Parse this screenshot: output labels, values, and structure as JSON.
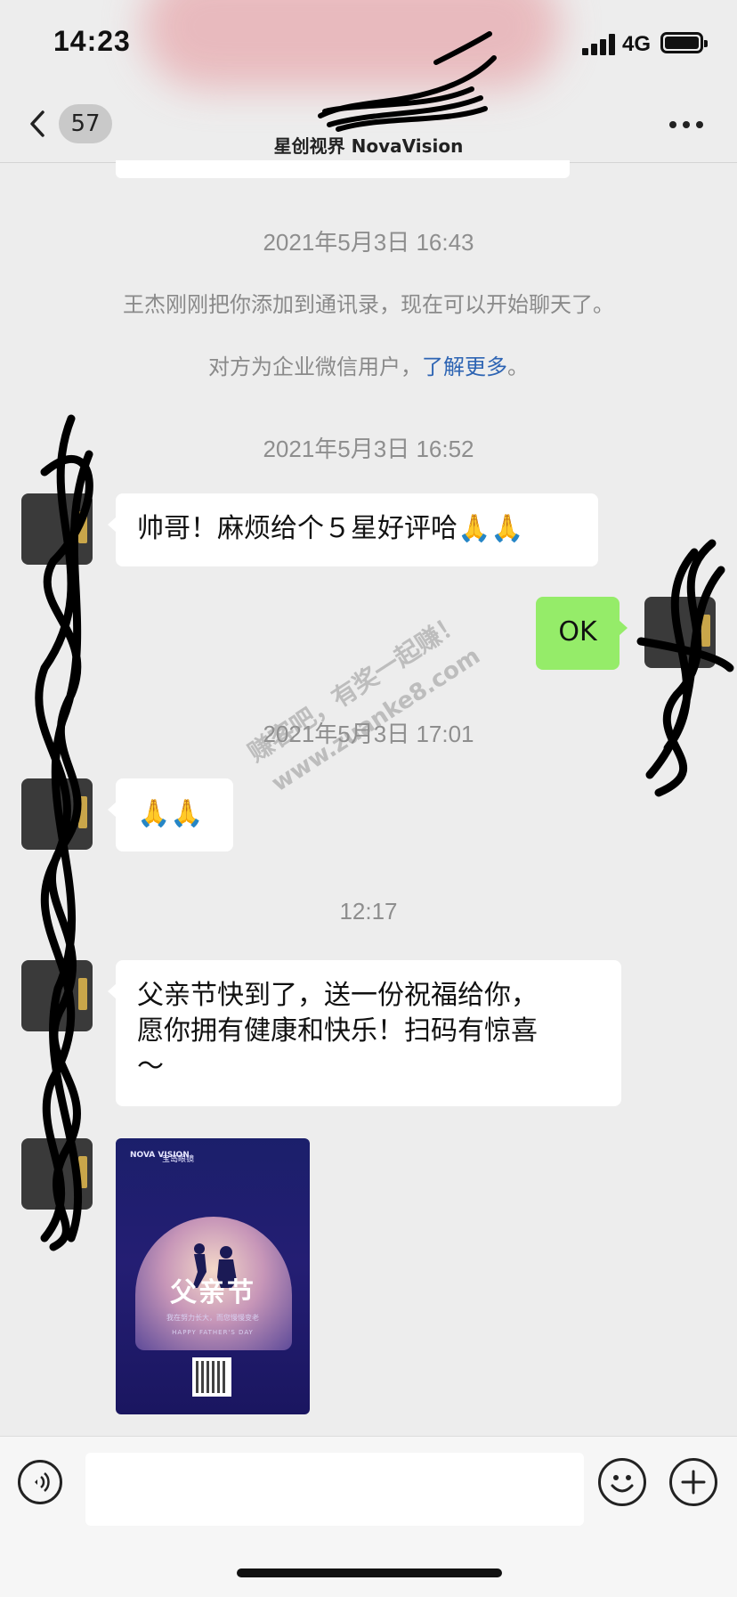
{
  "status": {
    "time": "14:23",
    "network": "4G"
  },
  "nav": {
    "back_count": "57",
    "title": "星创视界 NovaVision"
  },
  "messages": {
    "ts1": "2021年5月3日 16:43",
    "sys1": "王杰刚刚把你添加到通讯录，现在可以开始聊天了。",
    "sys2_prefix": "对方为企业微信用户，",
    "sys2_link": "了解更多",
    "sys2_suffix": "。",
    "ts2": "2021年5月3日 16:52",
    "msg1": "帅哥！麻烦给个５星好评哈",
    "msg1_emoji": "🙏🙏",
    "msg2_out": "OK",
    "ts3": "2021年5月3日 17:01",
    "msg3_emoji": "🙏🙏",
    "ts4": "12:17",
    "msg4_line1": "父亲节快到了，送一份祝福给你，",
    "msg4_line2": "愿你拥有健康和快乐！扫码有惊喜",
    "msg4_line3": "～"
  },
  "poster": {
    "brand": "NOVA VISION",
    "brand_cn": "星创视界",
    "partner": "宝岛眼镜",
    "headline": "父亲节",
    "subline": "我在努力长大，而您慢慢变老",
    "english": "HAPPY FATHER'S DAY"
  },
  "watermark": {
    "line1": "赚客吧，有奖一起赚！",
    "line2": "www.zuanke8.com"
  },
  "icons": {
    "back": "chevron-left-icon",
    "more": "more-dots-icon",
    "voice": "voice-icon",
    "emoji": "emoji-icon",
    "plus": "plus-icon"
  },
  "colors": {
    "outgoing_bubble": "#95ec69",
    "link": "#2d64b3",
    "background": "#ededed"
  }
}
